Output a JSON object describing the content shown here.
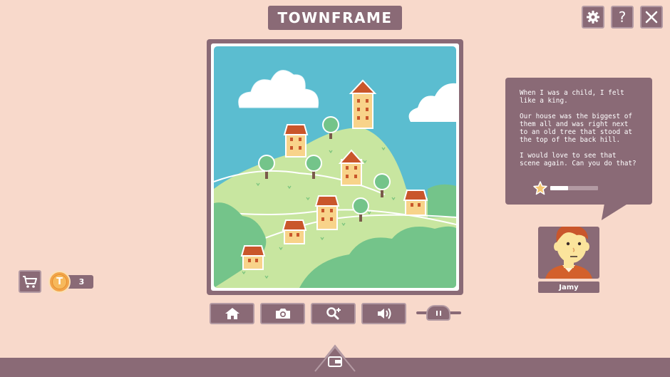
{
  "header": {
    "title": "TOWNFRAME"
  },
  "top_buttons": {
    "settings_icon": "gear-icon",
    "help_label": "?",
    "close_icon": "close-icon"
  },
  "toolbar": {
    "buttons": [
      {
        "icon": "home-icon"
      },
      {
        "icon": "camera-icon"
      },
      {
        "icon": "zoom-in-icon"
      },
      {
        "icon": "speaker-icon"
      }
    ],
    "slider": {
      "icon": "pause-icon"
    }
  },
  "shop": {
    "cart_icon": "cart-icon",
    "coin_symbol": "T",
    "coin_count": "3"
  },
  "dialogue": {
    "paragraphs": [
      "When I was a child, I felt like a king.",
      "Our house was the biggest of them all and was right next to an old tree that stood at the top of the back hill.",
      "I would love to see that scene again. Can you do that?"
    ],
    "progress": 0.38,
    "star_icon": "star-icon"
  },
  "character": {
    "name": "Jamy"
  },
  "colors": {
    "background": "#f8d9cb",
    "panel": "#8a6a76",
    "sky": "#5bbdd0",
    "grass": "#c8e6a0",
    "bush": "#74c48a",
    "roof": "#c9562b",
    "wall": "#f8d38a"
  }
}
